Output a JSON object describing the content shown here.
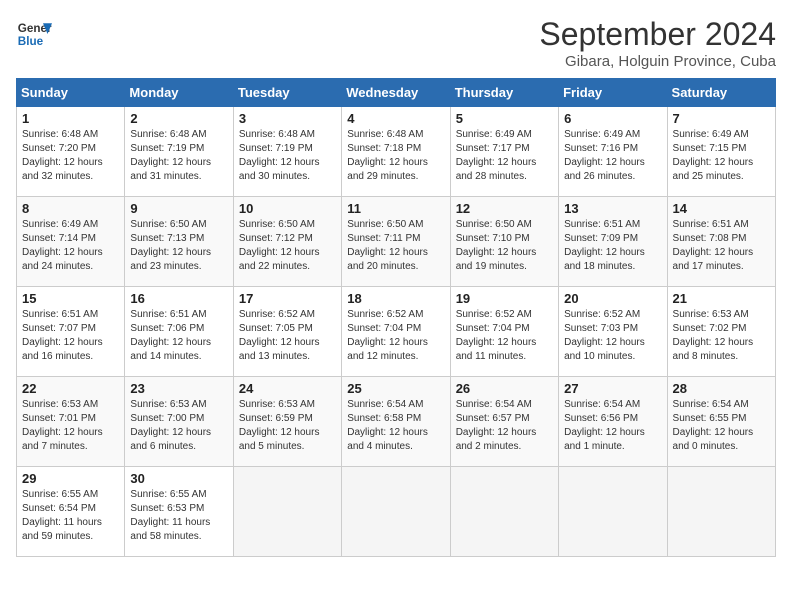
{
  "header": {
    "logo_line1": "General",
    "logo_line2": "Blue",
    "month_year": "September 2024",
    "location": "Gibara, Holguin Province, Cuba"
  },
  "weekdays": [
    "Sunday",
    "Monday",
    "Tuesday",
    "Wednesday",
    "Thursday",
    "Friday",
    "Saturday"
  ],
  "weeks": [
    [
      {
        "day": "1",
        "info": "Sunrise: 6:48 AM\nSunset: 7:20 PM\nDaylight: 12 hours\nand 32 minutes."
      },
      {
        "day": "2",
        "info": "Sunrise: 6:48 AM\nSunset: 7:19 PM\nDaylight: 12 hours\nand 31 minutes."
      },
      {
        "day": "3",
        "info": "Sunrise: 6:48 AM\nSunset: 7:19 PM\nDaylight: 12 hours\nand 30 minutes."
      },
      {
        "day": "4",
        "info": "Sunrise: 6:48 AM\nSunset: 7:18 PM\nDaylight: 12 hours\nand 29 minutes."
      },
      {
        "day": "5",
        "info": "Sunrise: 6:49 AM\nSunset: 7:17 PM\nDaylight: 12 hours\nand 28 minutes."
      },
      {
        "day": "6",
        "info": "Sunrise: 6:49 AM\nSunset: 7:16 PM\nDaylight: 12 hours\nand 26 minutes."
      },
      {
        "day": "7",
        "info": "Sunrise: 6:49 AM\nSunset: 7:15 PM\nDaylight: 12 hours\nand 25 minutes."
      }
    ],
    [
      {
        "day": "8",
        "info": "Sunrise: 6:49 AM\nSunset: 7:14 PM\nDaylight: 12 hours\nand 24 minutes."
      },
      {
        "day": "9",
        "info": "Sunrise: 6:50 AM\nSunset: 7:13 PM\nDaylight: 12 hours\nand 23 minutes."
      },
      {
        "day": "10",
        "info": "Sunrise: 6:50 AM\nSunset: 7:12 PM\nDaylight: 12 hours\nand 22 minutes."
      },
      {
        "day": "11",
        "info": "Sunrise: 6:50 AM\nSunset: 7:11 PM\nDaylight: 12 hours\nand 20 minutes."
      },
      {
        "day": "12",
        "info": "Sunrise: 6:50 AM\nSunset: 7:10 PM\nDaylight: 12 hours\nand 19 minutes."
      },
      {
        "day": "13",
        "info": "Sunrise: 6:51 AM\nSunset: 7:09 PM\nDaylight: 12 hours\nand 18 minutes."
      },
      {
        "day": "14",
        "info": "Sunrise: 6:51 AM\nSunset: 7:08 PM\nDaylight: 12 hours\nand 17 minutes."
      }
    ],
    [
      {
        "day": "15",
        "info": "Sunrise: 6:51 AM\nSunset: 7:07 PM\nDaylight: 12 hours\nand 16 minutes."
      },
      {
        "day": "16",
        "info": "Sunrise: 6:51 AM\nSunset: 7:06 PM\nDaylight: 12 hours\nand 14 minutes."
      },
      {
        "day": "17",
        "info": "Sunrise: 6:52 AM\nSunset: 7:05 PM\nDaylight: 12 hours\nand 13 minutes."
      },
      {
        "day": "18",
        "info": "Sunrise: 6:52 AM\nSunset: 7:04 PM\nDaylight: 12 hours\nand 12 minutes."
      },
      {
        "day": "19",
        "info": "Sunrise: 6:52 AM\nSunset: 7:04 PM\nDaylight: 12 hours\nand 11 minutes."
      },
      {
        "day": "20",
        "info": "Sunrise: 6:52 AM\nSunset: 7:03 PM\nDaylight: 12 hours\nand 10 minutes."
      },
      {
        "day": "21",
        "info": "Sunrise: 6:53 AM\nSunset: 7:02 PM\nDaylight: 12 hours\nand 8 minutes."
      }
    ],
    [
      {
        "day": "22",
        "info": "Sunrise: 6:53 AM\nSunset: 7:01 PM\nDaylight: 12 hours\nand 7 minutes."
      },
      {
        "day": "23",
        "info": "Sunrise: 6:53 AM\nSunset: 7:00 PM\nDaylight: 12 hours\nand 6 minutes."
      },
      {
        "day": "24",
        "info": "Sunrise: 6:53 AM\nSunset: 6:59 PM\nDaylight: 12 hours\nand 5 minutes."
      },
      {
        "day": "25",
        "info": "Sunrise: 6:54 AM\nSunset: 6:58 PM\nDaylight: 12 hours\nand 4 minutes."
      },
      {
        "day": "26",
        "info": "Sunrise: 6:54 AM\nSunset: 6:57 PM\nDaylight: 12 hours\nand 2 minutes."
      },
      {
        "day": "27",
        "info": "Sunrise: 6:54 AM\nSunset: 6:56 PM\nDaylight: 12 hours\nand 1 minute."
      },
      {
        "day": "28",
        "info": "Sunrise: 6:54 AM\nSunset: 6:55 PM\nDaylight: 12 hours\nand 0 minutes."
      }
    ],
    [
      {
        "day": "29",
        "info": "Sunrise: 6:55 AM\nSunset: 6:54 PM\nDaylight: 11 hours\nand 59 minutes."
      },
      {
        "day": "30",
        "info": "Sunrise: 6:55 AM\nSunset: 6:53 PM\nDaylight: 11 hours\nand 58 minutes."
      },
      null,
      null,
      null,
      null,
      null
    ]
  ]
}
